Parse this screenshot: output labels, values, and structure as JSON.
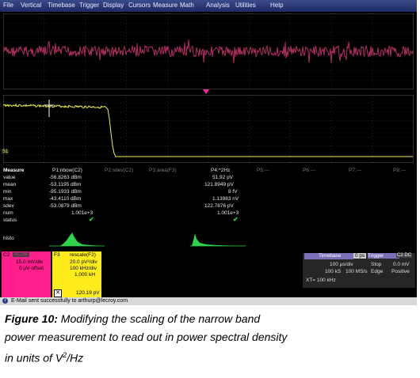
{
  "menu": [
    "File",
    "Vertical",
    "Timebase",
    "Trigger",
    "Display",
    "Cursors",
    "Measure",
    "Math",
    "Analysis",
    "Utilities",
    "Help"
  ],
  "markers": {
    "lower_ground": "S1"
  },
  "measurements": {
    "title": "Measure",
    "headers": [
      "P1:nbow(C2)",
      "P2:sdev(C2)",
      "P3:area(F3)",
      "P4:^2Hz",
      "P5:---",
      "P6:---",
      "P7:---",
      "P8:---"
    ],
    "row_labels": [
      "value",
      "mean",
      "min",
      "max",
      "sdev",
      "num",
      "status"
    ],
    "p1": [
      "-56.8263 dBm",
      "-53.1195 dBm",
      "-95.1933 dBm",
      "-43.4110 dBm",
      "-53.0879 dBm",
      "1.001e+3"
    ],
    "p4": [
      "51.92 pV",
      "121.8949 pV",
      "8 fV",
      "1.13983 nV",
      "122.7876 pV",
      "1.001e+3"
    ],
    "histo_label": "histo"
  },
  "channels": {
    "c2": {
      "label": "C2",
      "tag": "AC1M",
      "lines": [
        "15.0 mV/div",
        "0 µV offset"
      ]
    },
    "f3": {
      "label": "F3",
      "name": "rescale(F2)",
      "lines": [
        "20.0 pV²/div",
        "100 kHz/div",
        "1.000 kH"
      ],
      "footer": "120.19 pV"
    }
  },
  "timebase": {
    "label": "Timebase",
    "value": "0 ps",
    "lines": [
      [
        "100 µs/div",
        "Stop",
        "0.0 mV"
      ],
      [
        "100 kS",
        "100 MS/s",
        "Edge",
        "Positive"
      ]
    ],
    "xt": "XT=  100 kHz"
  },
  "trigger": {
    "label": "Trigger",
    "tag": "C2 DC"
  },
  "status": "E-Mail sent successfully to  arthurp@lecroy.com",
  "caption": {
    "fig": "Figure 10:",
    "line1": "  Modifying the scaling of the narrow band",
    "line2": "power measurement to read out in power spectral density",
    "line3_pre": "in units of V",
    "sup": "2",
    "line3_post": "/Hz"
  },
  "colors": {
    "trace_noise": "#c0306a",
    "trace_psd": "#f5f04a",
    "menubar": "#1e2a66",
    "c2_tag": "#ff1e8c",
    "f3_tag": "#ffec1c",
    "tb_tag": "#7b6fb8"
  }
}
